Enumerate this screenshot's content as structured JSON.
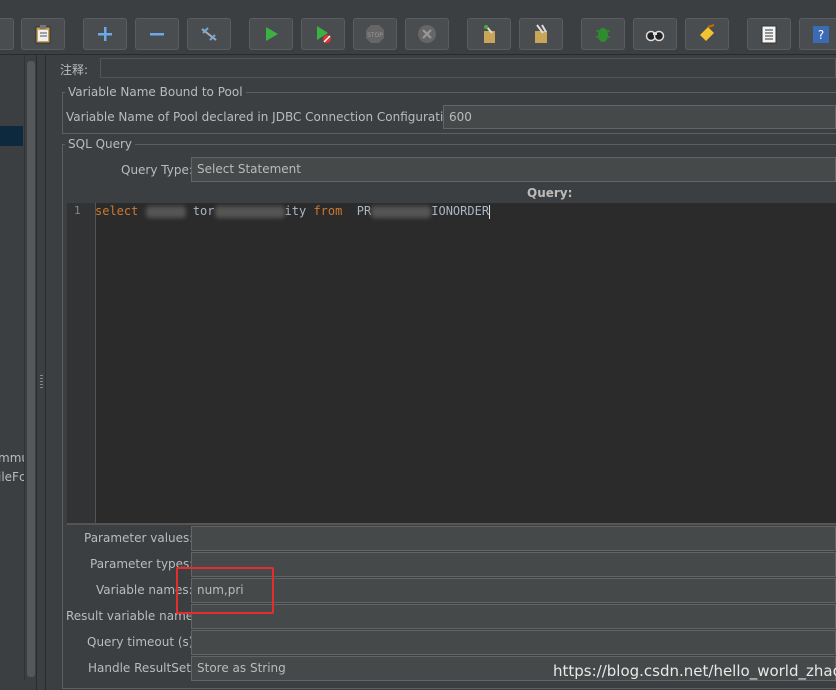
{
  "toolbar": {
    "buttons": [
      {
        "icon": "new-icon"
      },
      {
        "icon": "clipboard-icon"
      },
      {
        "icon": "add-icon"
      },
      {
        "icon": "remove-icon"
      },
      {
        "icon": "toggle-icon"
      },
      {
        "icon": "start-icon"
      },
      {
        "icon": "start-no-pauses-icon"
      },
      {
        "icon": "stop-icon"
      },
      {
        "icon": "shutdown-icon"
      },
      {
        "icon": "clear-icon"
      },
      {
        "icon": "clear-all-icon"
      },
      {
        "icon": "function-helper-icon"
      },
      {
        "icon": "search-icon"
      },
      {
        "icon": "reset-search-icon"
      },
      {
        "icon": "log-viewer-icon"
      },
      {
        "icon": "help-icon"
      }
    ]
  },
  "left_tree": {
    "items": [
      "mmu",
      "ileFc"
    ]
  },
  "comment": {
    "label": "注释:"
  },
  "pool_section": {
    "title": "Variable Name Bound to Pool",
    "pool_label": "Variable Name of Pool declared in JDBC Connection Configuration:",
    "pool_value": "600"
  },
  "sql_section": {
    "title": "SQL Query",
    "query_type_label": "Query Type:",
    "query_type_value": "Select Statement",
    "query_label": "Query:",
    "line_number": "1",
    "code": {
      "kw1": "select",
      "frag1": "tor",
      "frag2": "ity",
      "kw2": "from",
      "frag3": "PR",
      "frag4": "IONORDER"
    }
  },
  "params": {
    "parameter_values_label": "Parameter values:",
    "parameter_values_value": "",
    "parameter_types_label": "Parameter types:",
    "parameter_types_value": "",
    "variable_names_label": "Variable names:",
    "variable_names_value": "num,pri",
    "result_variable_label": "Result variable name:",
    "result_variable_value": "",
    "query_timeout_label": "Query timeout (s):",
    "query_timeout_value": "",
    "handle_resultset_label": "Handle ResultSet:",
    "handle_resultset_value": "Store as String"
  },
  "watermark": "https://blog.csdn.net/hello_world_zhao",
  "colors": {
    "background": "#3c3f41",
    "editor_bg": "#2b2b2b",
    "keyword": "#cc7832",
    "highlight": "#e52d2d"
  }
}
